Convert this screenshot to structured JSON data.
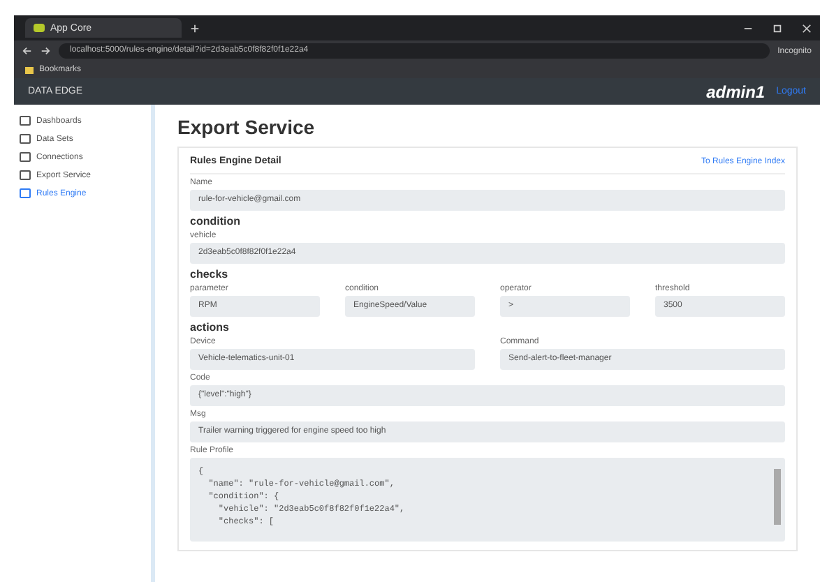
{
  "browser": {
    "tab_title": "App Core",
    "url": "localhost:5000/rules-engine/detail?id=2d3eab5c0f8f82f0f1e22a4",
    "profile": "Incognito",
    "bookmark": "Bookmarks"
  },
  "app": {
    "brand": "DATA EDGE",
    "user": "admin1",
    "logout": "Logout"
  },
  "sidebar": {
    "items": [
      {
        "label": "Dashboards",
        "selected": false
      },
      {
        "label": "Data Sets",
        "selected": false
      },
      {
        "label": "Connections",
        "selected": false
      },
      {
        "label": "Export Service",
        "selected": false
      },
      {
        "label": "Rules Engine",
        "selected": true
      }
    ]
  },
  "page_title": "Export Service",
  "card": {
    "title": "Rules Engine Detail",
    "link": "To Rules Engine Index",
    "name": {
      "label": "Name",
      "value": "rule-for-vehicle@gmail.com"
    },
    "condition": {
      "heading": "condition",
      "label": "vehicle",
      "value": "2d3eab5c0f8f82f0f1e22a4"
    },
    "checks": {
      "heading": "checks",
      "fields": [
        {
          "label": "parameter",
          "value": "RPM"
        },
        {
          "label": "condition",
          "value": "EngineSpeed/Value"
        },
        {
          "label": "operator",
          "value": ">"
        },
        {
          "label": "threshold",
          "value": "3500"
        }
      ]
    },
    "actions": {
      "heading": "actions",
      "fields": [
        {
          "label": "Device",
          "value": "Vehicle-telematics-unit-01"
        },
        {
          "label": "Command",
          "value": "Send-alert-to-fleet-manager"
        }
      ],
      "code": {
        "label": "Code",
        "value": "{\"level\":\"high\"}"
      },
      "msg": {
        "label": "Msg",
        "value": "Trailer warning triggered for engine speed too high"
      }
    },
    "profile": {
      "label": "Rule Profile",
      "lines": [
        "{",
        "  \"name\": \"rule-for-vehicle@gmail.com\",",
        "  \"condition\": {",
        "    \"vehicle\": \"2d3eab5c0f8f82f0f1e22a4\",",
        "    \"checks\": ["
      ]
    }
  }
}
